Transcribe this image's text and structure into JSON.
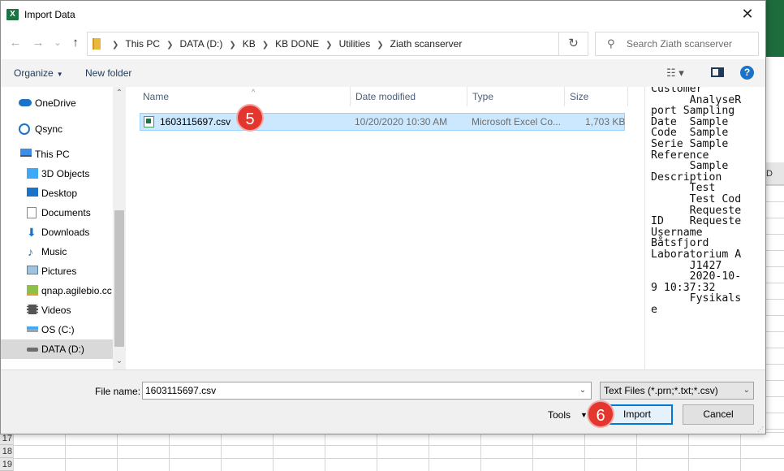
{
  "dialog": {
    "app_icon": "X",
    "title": "Import Data",
    "close_glyph": "✕"
  },
  "nav": {
    "back_glyph": "←",
    "forward_glyph": "→",
    "recent_glyph": "⌄",
    "up_glyph": "↑",
    "breadcrumbs": [
      "This PC",
      "DATA (D:)",
      "KB",
      "KB DONE",
      "Utilities",
      "Ziath scanserver"
    ],
    "refresh_glyph": "↻",
    "search_placeholder": "Search Ziath scanserver"
  },
  "toolbar": {
    "organize_label": "Organize",
    "new_folder_label": "New folder"
  },
  "sidebar": {
    "items": [
      {
        "label": "OneDrive",
        "icon": "cloud-icon"
      },
      {
        "label": "Qsync",
        "icon": "sync-icon"
      },
      {
        "label": "This PC",
        "icon": "computer-icon"
      },
      {
        "label": "3D Objects",
        "icon": "cube-icon"
      },
      {
        "label": "Desktop",
        "icon": "desktop-icon"
      },
      {
        "label": "Documents",
        "icon": "document-icon"
      },
      {
        "label": "Downloads",
        "icon": "download-icon"
      },
      {
        "label": "Music",
        "icon": "music-icon"
      },
      {
        "label": "Pictures",
        "icon": "pictures-icon"
      },
      {
        "label": "qnap.agilebio.cc",
        "icon": "network-drive-icon"
      },
      {
        "label": "Videos",
        "icon": "video-icon"
      },
      {
        "label": "OS (C:)",
        "icon": "disk-icon"
      },
      {
        "label": "DATA (D:)",
        "icon": "disk-icon"
      }
    ]
  },
  "filelist": {
    "columns": [
      "Name",
      "Date modified",
      "Type",
      "Size"
    ],
    "rows": [
      {
        "name": "1603115697.csv",
        "date": "10/20/2020 10:30 AM",
        "type": "Microsoft Excel Co...",
        "size": "1,703 KB"
      }
    ]
  },
  "preview": {
    "text": "Customer\n      AnalyseR\nport Sampling\nDate  Sample\nCode  Sample\nSerie Sample\nReference\n      Sample\nDescription\n      Test\n      Test Cod\n      Requeste\nID    Requeste\nUsername\nBåtsfjord\nLaboratorium A\n      J1427\n      2020-10-\n9 10:37:32\n      Fysikals\ne"
  },
  "bottom": {
    "file_name_label": "File name:",
    "file_name_value": "1603115697.csv",
    "file_type_value": "Text Files (*.prn;*.txt;*.csv)",
    "tools_label": "Tools",
    "import_label": "Import",
    "cancel_label": "Cancel"
  },
  "annotations": {
    "step5": "5",
    "step6": "6"
  },
  "sheet": {
    "col_letter": "D",
    "row_17": "17",
    "row_18": "18",
    "row_19": "19"
  },
  "colors": {
    "accent": "#0078d7",
    "selection": "#cce8ff",
    "badge": "#e2362f",
    "excel_green": "#217346"
  }
}
